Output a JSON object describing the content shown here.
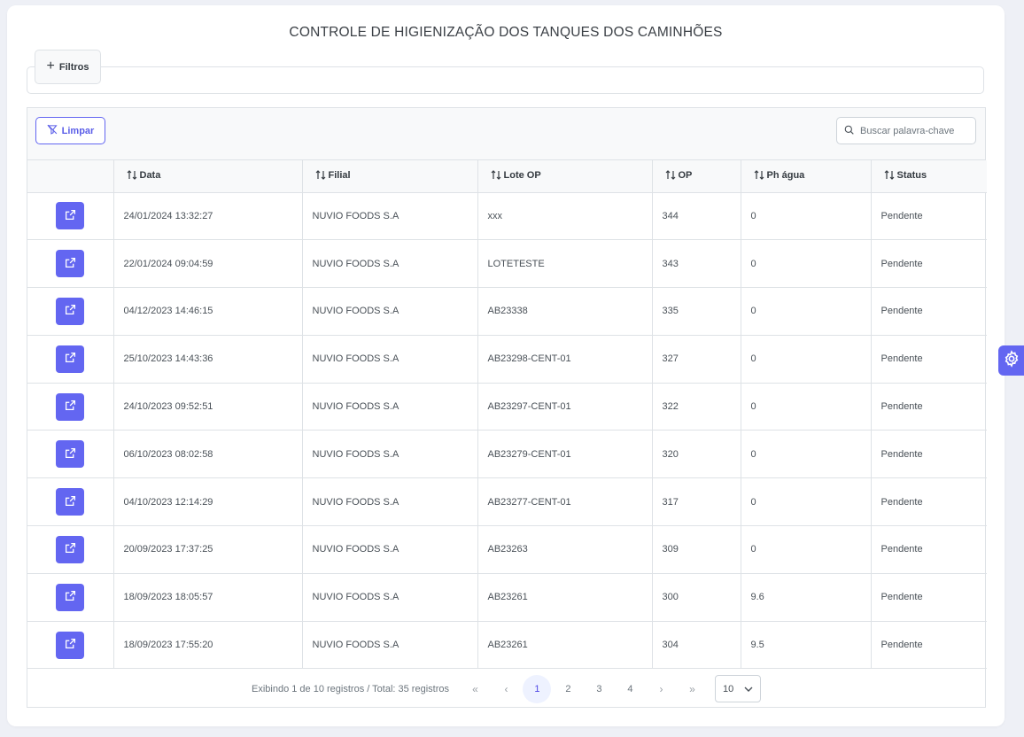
{
  "page": {
    "title": "CONTROLE DE HIGIENIZAÇÃO DOS TANQUES DOS CAMINHÕES"
  },
  "filters": {
    "toggle_label": "Filtros",
    "toggle_icon": "plus-icon"
  },
  "toolbar": {
    "clear_label": "Limpar",
    "clear_icon": "filter-slash-icon",
    "search_placeholder": "Buscar palavra-chave",
    "search_value": ""
  },
  "table": {
    "columns": [
      "Data",
      "Filial",
      "Lote OP",
      "OP",
      "Ph água",
      "Status"
    ],
    "rows": [
      {
        "data": "24/01/2024 13:32:27",
        "filial": "NUVIO FOODS S.A",
        "lote": "xxx",
        "op": "344",
        "ph": "0",
        "status": "Pendente"
      },
      {
        "data": "22/01/2024 09:04:59",
        "filial": "NUVIO FOODS S.A",
        "lote": "LOTETESTE",
        "op": "343",
        "ph": "0",
        "status": "Pendente"
      },
      {
        "data": "04/12/2023 14:46:15",
        "filial": "NUVIO FOODS S.A",
        "lote": "AB23338",
        "op": "335",
        "ph": "0",
        "status": "Pendente"
      },
      {
        "data": "25/10/2023 14:43:36",
        "filial": "NUVIO FOODS S.A",
        "lote": "AB23298-CENT-01",
        "op": "327",
        "ph": "0",
        "status": "Pendente"
      },
      {
        "data": "24/10/2023 09:52:51",
        "filial": "NUVIO FOODS S.A",
        "lote": "AB23297-CENT-01",
        "op": "322",
        "ph": "0",
        "status": "Pendente"
      },
      {
        "data": "06/10/2023 08:02:58",
        "filial": "NUVIO FOODS S.A",
        "lote": "AB23279-CENT-01",
        "op": "320",
        "ph": "0",
        "status": "Pendente"
      },
      {
        "data": "04/10/2023 12:14:29",
        "filial": "NUVIO FOODS S.A",
        "lote": "AB23277-CENT-01",
        "op": "317",
        "ph": "0",
        "status": "Pendente"
      },
      {
        "data": "20/09/2023 17:37:25",
        "filial": "NUVIO FOODS S.A",
        "lote": "AB23263",
        "op": "309",
        "ph": "0",
        "status": "Pendente"
      },
      {
        "data": "18/09/2023 18:05:57",
        "filial": "NUVIO FOODS S.A",
        "lote": "AB23261",
        "op": "300",
        "ph": "9.6",
        "status": "Pendente"
      },
      {
        "data": "18/09/2023 17:55:20",
        "filial": "NUVIO FOODS S.A",
        "lote": "AB23261",
        "op": "304",
        "ph": "9.5",
        "status": "Pendente"
      }
    ]
  },
  "pagination": {
    "info": "Exibindo 1 de 10 registros / Total: 35 registros",
    "pages": [
      "1",
      "2",
      "3",
      "4"
    ],
    "current_page": "1",
    "first": "«",
    "prev": "‹",
    "next": "›",
    "last": "»",
    "rows_per_page": "10"
  },
  "colors": {
    "accent": "#6366f1",
    "background": "#eef0f6"
  }
}
